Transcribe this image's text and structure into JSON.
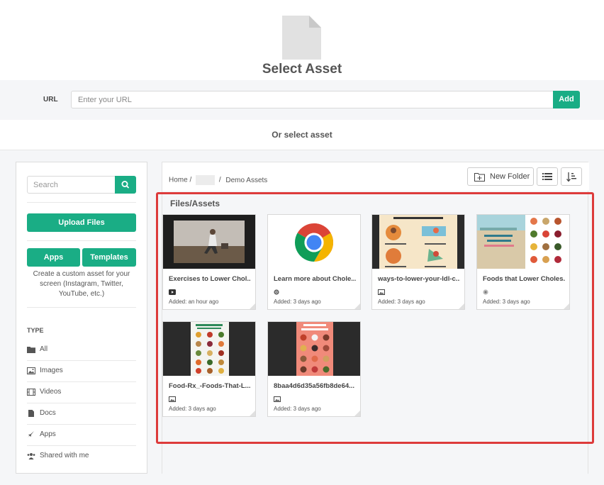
{
  "header": {
    "title": "Select Asset"
  },
  "url": {
    "label": "URL",
    "placeholder": "Enter your URL",
    "add_label": "Add"
  },
  "or_text": "Or select asset",
  "sidebar": {
    "search_placeholder": "Search",
    "upload_label": "Upload Files",
    "apps_label": "Apps",
    "templates_label": "Templates",
    "custom_text": "Create a custom asset for your screen (Instagram, Twitter, YouTube, etc.)",
    "type_heading": "TYPE",
    "types": [
      {
        "label": "All",
        "icon": "folder-icon"
      },
      {
        "label": "Images",
        "icon": "image-icon"
      },
      {
        "label": "Videos",
        "icon": "film-icon"
      },
      {
        "label": "Docs",
        "icon": "document-icon"
      },
      {
        "label": "Apps",
        "icon": "rocket-icon"
      },
      {
        "label": "Shared with me",
        "icon": "users-icon"
      }
    ]
  },
  "toolbar": {
    "breadcrumb_home": "Home",
    "breadcrumb_sep": "/",
    "breadcrumb_current": "Demo Assets",
    "new_folder_label": "New Folder"
  },
  "section_title": "Files/Assets",
  "assets": [
    {
      "title": "Exercises to Lower Chol...",
      "date": "Added: an hour ago",
      "type_icon": "youtube-icon",
      "thumb": "video"
    },
    {
      "title": "Learn more about Chole...",
      "date": "Added: 3 days ago",
      "type_icon": "chrome-icon",
      "thumb": "chrome"
    },
    {
      "title": "ways-to-lower-your-ldl-c...",
      "date": "Added: 3 days ago",
      "type_icon": "image-icon",
      "thumb": "infographic"
    },
    {
      "title": "Foods that Lower Choles...",
      "date": "Added: 3 days ago",
      "type_icon": "app-icon",
      "thumb": "foods"
    },
    {
      "title": "Food-Rx_-Foods-That-L...",
      "date": "Added: 3 days ago",
      "type_icon": "image-icon",
      "thumb": "poster"
    },
    {
      "title": "8baa4d6d35a56fb8de64...",
      "date": "Added: 3 days ago",
      "type_icon": "image-icon",
      "thumb": "poster-red"
    }
  ],
  "colors": {
    "accent": "#1aad85",
    "highlight": "#dd3b3b"
  }
}
